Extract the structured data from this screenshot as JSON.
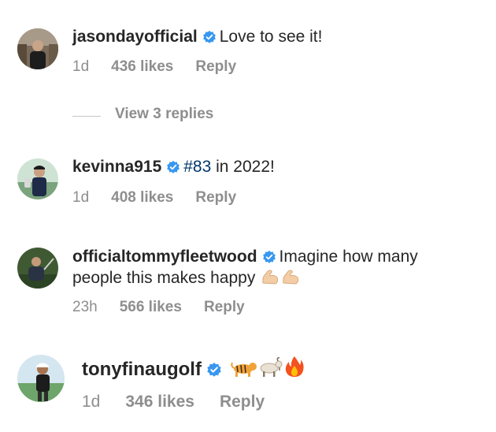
{
  "comments": [
    {
      "username": "jasondayofficial",
      "verified": true,
      "text": "Love to see it!",
      "time": "1d",
      "likes": "436 likes",
      "reply": "Reply"
    },
    {
      "username": "kevinna915",
      "verified": true,
      "hashtag": "#83",
      "text": " in 2022!",
      "time": "1d",
      "likes": "408 likes",
      "reply": "Reply"
    },
    {
      "username": "officialtommyfleetwood",
      "verified": true,
      "text": "Imagine how many",
      "text2": "people this makes happy",
      "emoji": [
        "flexed-biceps",
        "flexed-biceps"
      ],
      "time": "23h",
      "likes": "566 likes",
      "reply": "Reply"
    },
    {
      "username": "tonyfinaugolf",
      "verified": true,
      "emoji": [
        "tiger",
        "goat",
        "fire"
      ],
      "time": "1d",
      "likes": "346 likes",
      "reply": "Reply"
    }
  ],
  "view_replies": "View 3 replies",
  "colors": {
    "verified": "#3897f0",
    "meta": "#8e8e8e",
    "text": "#262626",
    "hashtag": "#00376b"
  }
}
